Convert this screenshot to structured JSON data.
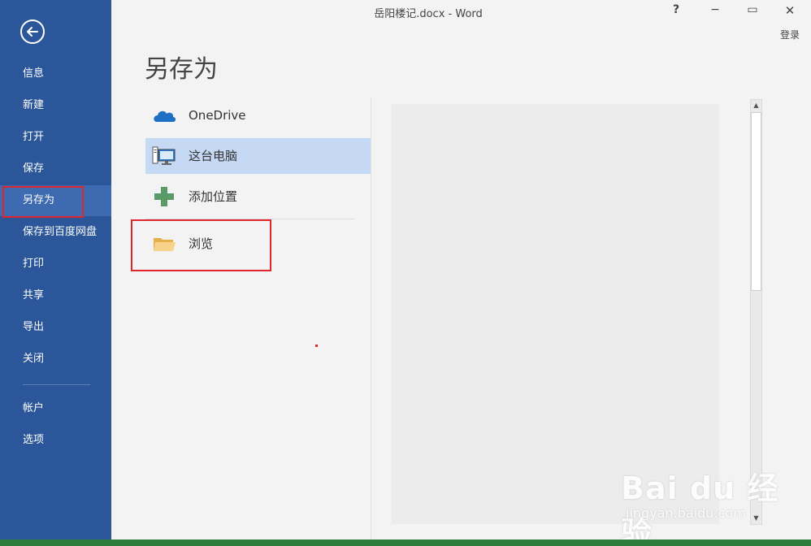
{
  "window": {
    "title": "岳阳楼记.docx - Word",
    "help": "?",
    "minimize": "−",
    "maximize": "▭",
    "close": "✕",
    "login": "登录"
  },
  "nav": {
    "back_icon": "back-arrow-icon",
    "items": [
      {
        "label": "信息"
      },
      {
        "label": "新建"
      },
      {
        "label": "打开"
      },
      {
        "label": "保存"
      },
      {
        "label": "另存为",
        "selected": true
      },
      {
        "label": "保存到百度网盘"
      },
      {
        "label": "打印"
      },
      {
        "label": "共享"
      },
      {
        "label": "导出"
      },
      {
        "label": "关闭"
      },
      {
        "label": "帐户"
      },
      {
        "label": "选项"
      }
    ]
  },
  "main": {
    "title": "另存为",
    "places": [
      {
        "label": "OneDrive",
        "icon": "onedrive-cloud-icon"
      },
      {
        "label": "这台电脑",
        "icon": "computer-icon",
        "selected": true
      },
      {
        "label": "添加位置",
        "icon": "plus-icon"
      },
      {
        "label": "浏览",
        "icon": "folder-icon"
      }
    ]
  },
  "watermark": {
    "logo": "Bai du 经验",
    "url": "jingyan.baidu.com"
  },
  "colors": {
    "nav_bg": "#2b579a",
    "nav_selected": "#3d6ab1",
    "place_selected": "#c5d9f4",
    "annotation_red": "#e0262a"
  }
}
